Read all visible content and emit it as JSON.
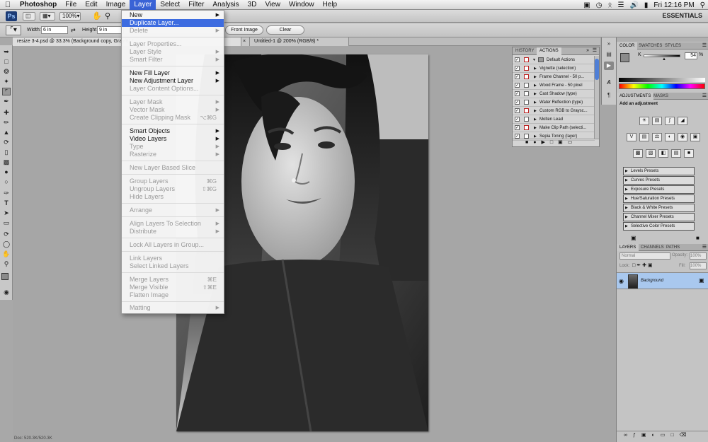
{
  "menubar": {
    "app_name": "Photoshop",
    "items": [
      "File",
      "Edit",
      "Image",
      "Layer",
      "Select",
      "Filter",
      "Analysis",
      "3D",
      "View",
      "Window",
      "Help"
    ],
    "active_item": "Layer",
    "clock": "Fri 12:16 PM"
  },
  "appbar": {
    "logo": "Ps",
    "zoom": "100%",
    "workspace": "ESSENTIALS"
  },
  "options": {
    "width_label": "Width:",
    "width_value": "6 in",
    "height_label": "Height:",
    "height_value": "9 in",
    "front_image": "Front Image",
    "clear": "Clear"
  },
  "tabs": {
    "tab1": "resize 3-4.psd @ 33.3% (Background copy, Gray/8) *",
    "tab2": "Untitled-1 @ 200% (RGB/8) *"
  },
  "layer_menu": {
    "new": "New",
    "duplicate": "Duplicate Layer...",
    "delete": "Delete",
    "layer_properties": "Layer Properties...",
    "layer_style": "Layer Style",
    "smart_filter": "Smart Filter",
    "new_fill": "New Fill Layer",
    "new_adjustment": "New Adjustment Layer",
    "content_options": "Layer Content Options...",
    "layer_mask": "Layer Mask",
    "vector_mask": "Vector Mask",
    "clipping_mask": "Create Clipping Mask",
    "clipping_mask_sc": "⌥⌘G",
    "smart_objects": "Smart Objects",
    "video_layers": "Video Layers",
    "type": "Type",
    "rasterize": "Rasterize",
    "new_based_slice": "New Layer Based Slice",
    "group_layers": "Group Layers",
    "group_layers_sc": "⌘G",
    "ungroup_layers": "Ungroup Layers",
    "ungroup_layers_sc": "⇧⌘G",
    "hide_layers": "Hide Layers",
    "arrange": "Arrange",
    "align_to_selection": "Align Layers To Selection",
    "distribute": "Distribute",
    "lock_all": "Lock All Layers in Group...",
    "link_layers": "Link Layers",
    "select_linked": "Select Linked Layers",
    "merge_layers": "Merge Layers",
    "merge_layers_sc": "⌘E",
    "merge_visible": "Merge Visible",
    "merge_visible_sc": "⇧⌘E",
    "flatten": "Flatten Image",
    "matting": "Matting"
  },
  "actions_panel": {
    "tab_history": "HISTORY",
    "tab_actions": "ACTIONS",
    "set_name": "Default Actions",
    "items": [
      "Vignette (selection)",
      "Frame Channel - 50 p...",
      "Wood Frame - 50 pixel",
      "Cast Shadow (type)",
      "Water Reflection (type)",
      "Custom RGB to Graysc...",
      "Molten Lead",
      "Make Clip Path (selecti...",
      "Sepia Toning (layer)"
    ]
  },
  "color_panel": {
    "tab_color": "COLOR",
    "tab_swatches": "SWATCHES",
    "tab_styles": "STYLES",
    "k_label": "K",
    "k_value": "54",
    "k_unit": "%"
  },
  "adjustments_panel": {
    "tab_adjustments": "ADJUSTMENTS",
    "tab_masks": "MASKS",
    "title": "Add an adjustment",
    "presets": [
      "Levels Presets",
      "Curves Presets",
      "Exposure Presets",
      "Hue/Saturation Presets",
      "Black & White Presets",
      "Channel Mixer Presets",
      "Selective Color Presets"
    ]
  },
  "layers_panel": {
    "tab_layers": "LAYERS",
    "tab_channels": "CHANNELS",
    "tab_paths": "PATHS",
    "blend_mode": "Normal",
    "opacity_label": "Opacity:",
    "opacity_value": "100%",
    "lock_label": "Lock:",
    "fill_label": "Fill:",
    "fill_value": "100%",
    "layer_name": "Background"
  },
  "status": {
    "doc": "Doc: 520.3K/520.3K"
  }
}
